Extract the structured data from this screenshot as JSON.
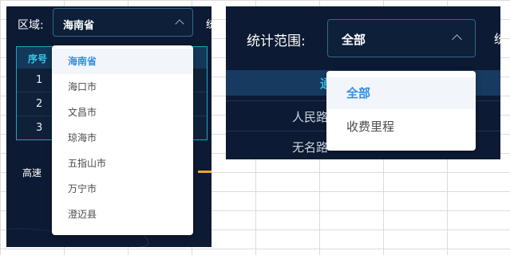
{
  "left_panel": {
    "filter_label": "区域:",
    "select_value": "海南省",
    "edge_char": "统",
    "table": {
      "header": "序号",
      "rows": [
        "1",
        "2",
        "3"
      ]
    },
    "speed_label": "高速",
    "dropdown_options": [
      "海南省",
      "海口市",
      "文昌市",
      "琼海市",
      "五指山市",
      "万宁市",
      "澄迈县"
    ],
    "selected_option": "海南省"
  },
  "right_panel": {
    "filter_label": "统计范围:",
    "select_value": "全部",
    "edge_char": "统",
    "table": {
      "header": "通",
      "rows": [
        "人民路",
        "无名路"
      ]
    },
    "dropdown_options": [
      "全部",
      "收费里程"
    ],
    "selected_option": "全部"
  },
  "colors": {
    "panel_bg": "#0d1a33",
    "accent_cyan": "#33c8e8",
    "selected_blue": "#2f8fea",
    "bar_orange": "#f5a623"
  }
}
